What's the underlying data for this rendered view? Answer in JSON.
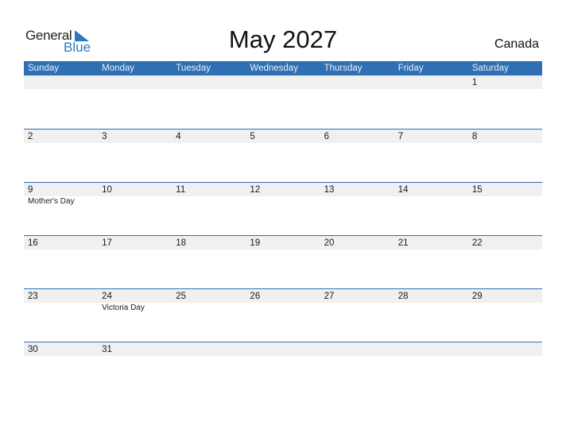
{
  "logo": {
    "general": "General",
    "blue": "Blue"
  },
  "header": {
    "title": "May 2027",
    "country": "Canada"
  },
  "weekdays": [
    "Sunday",
    "Monday",
    "Tuesday",
    "Wednesday",
    "Thursday",
    "Friday",
    "Saturday"
  ],
  "weeks": [
    {
      "days": [
        "",
        "",
        "",
        "",
        "",
        "",
        "1"
      ],
      "events": [
        "",
        "",
        "",
        "",
        "",
        "",
        ""
      ]
    },
    {
      "days": [
        "2",
        "3",
        "4",
        "5",
        "6",
        "7",
        "8"
      ],
      "events": [
        "",
        "",
        "",
        "",
        "",
        "",
        ""
      ]
    },
    {
      "days": [
        "9",
        "10",
        "11",
        "12",
        "13",
        "14",
        "15"
      ],
      "events": [
        "Mother's Day",
        "",
        "",
        "",
        "",
        "",
        ""
      ]
    },
    {
      "days": [
        "16",
        "17",
        "18",
        "19",
        "20",
        "21",
        "22"
      ],
      "events": [
        "",
        "",
        "",
        "",
        "",
        "",
        ""
      ]
    },
    {
      "days": [
        "23",
        "24",
        "25",
        "26",
        "27",
        "28",
        "29"
      ],
      "events": [
        "",
        "Victoria Day",
        "",
        "",
        "",
        "",
        ""
      ]
    },
    {
      "days": [
        "30",
        "31",
        "",
        "",
        "",
        "",
        ""
      ],
      "events": [
        "",
        "",
        "",
        "",
        "",
        "",
        ""
      ]
    }
  ],
  "colors": {
    "accent": "#2e70b3",
    "band": "#f0f0f0",
    "logo_blue": "#2b78c5"
  }
}
